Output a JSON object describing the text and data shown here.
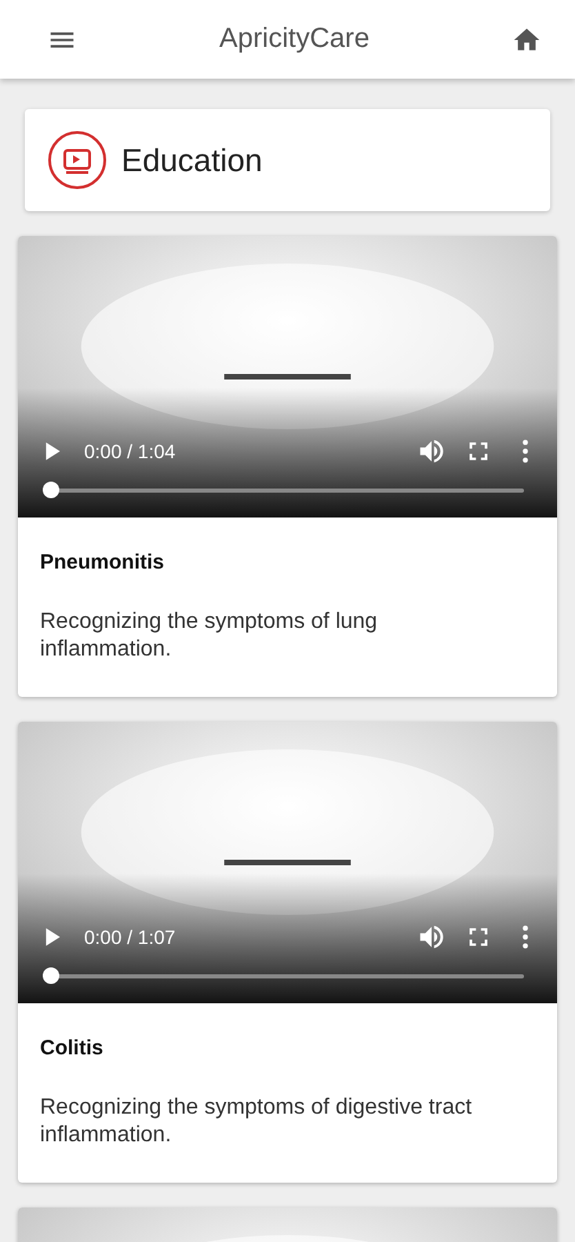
{
  "app_bar": {
    "title": "ApricityCare"
  },
  "section": {
    "title": "Education"
  },
  "videos": [
    {
      "kind": "video",
      "time": "0:00 / 1:04",
      "level": 0,
      "title": "Pneumonitis",
      "description": "Recognizing the symptoms of lung inflammation."
    },
    {
      "kind": "video",
      "time": "0:00 / 1:07",
      "level": 0,
      "title": "Colitis",
      "description": "Recognizing the symptoms of digestive tract inflammation."
    },
    {
      "kind": "partial"
    }
  ]
}
